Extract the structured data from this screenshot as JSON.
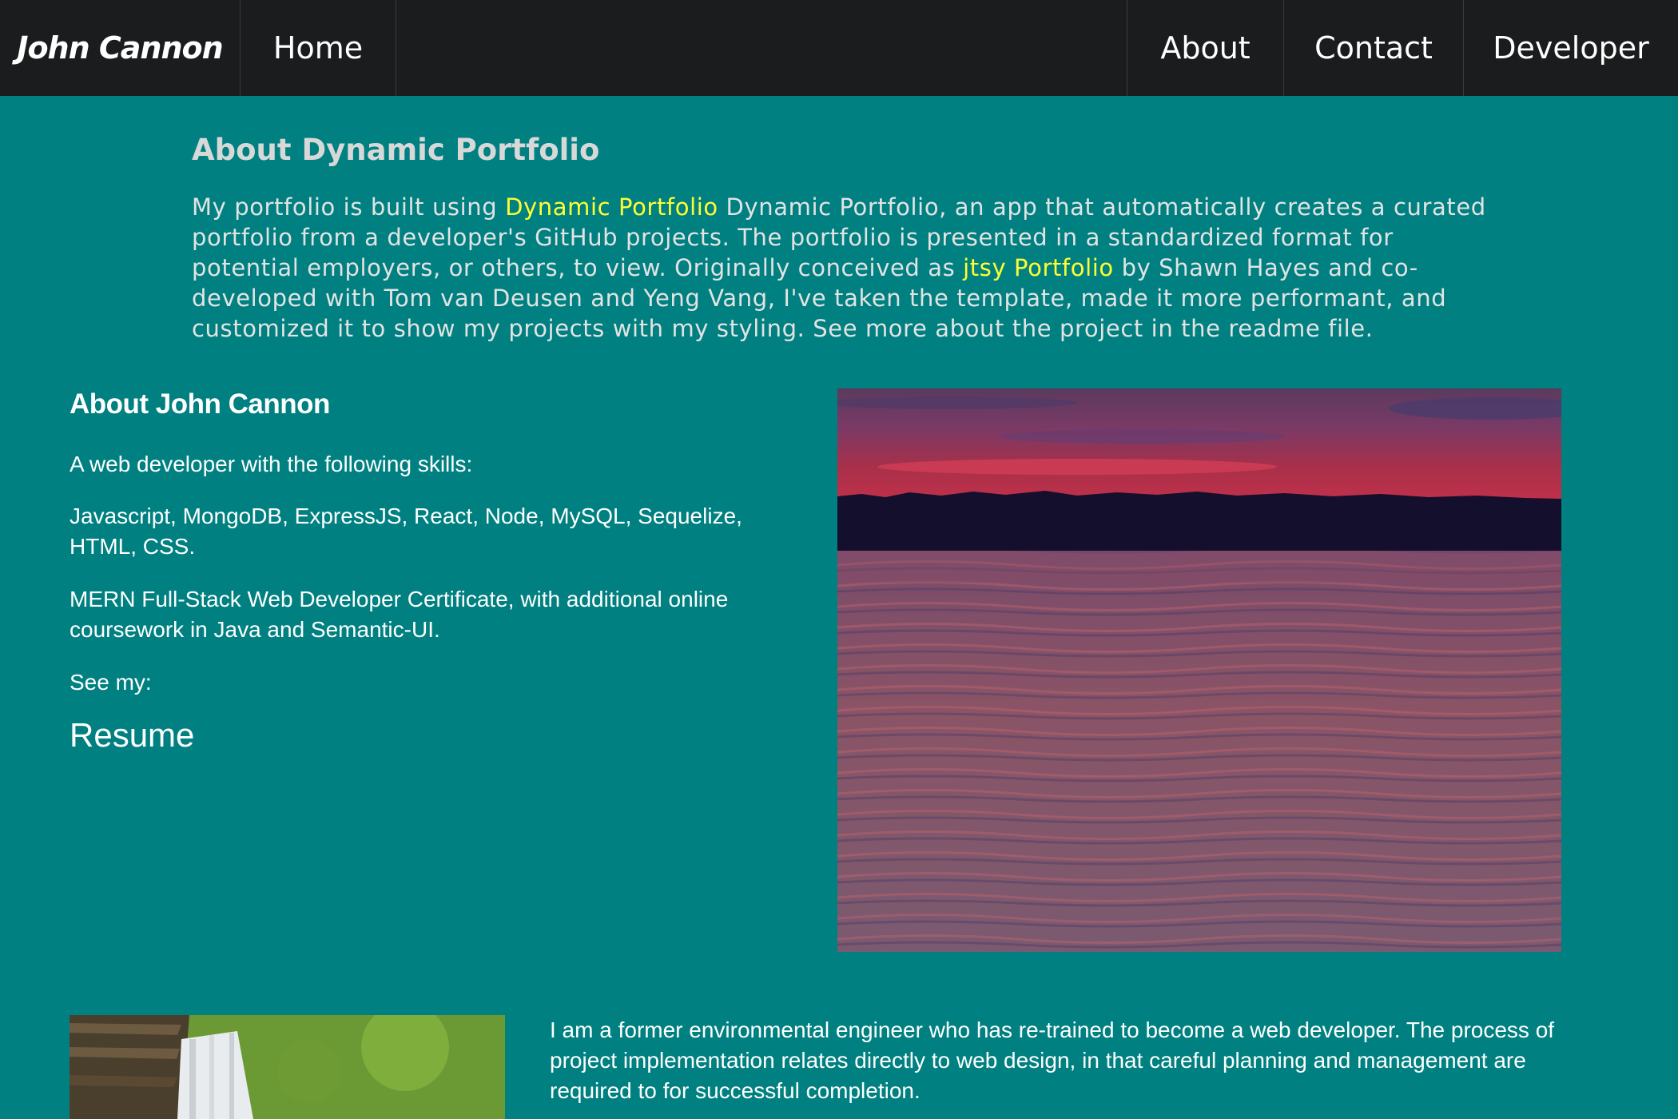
{
  "nav": {
    "brand": "John Cannon",
    "home": "Home",
    "about": "About",
    "contact": "Contact",
    "developer": "Developer"
  },
  "dynamic_portfolio": {
    "title": "About Dynamic Portfolio",
    "text_1": "My portfolio is built using ",
    "link_1": "Dynamic Portfolio",
    "text_2": " Dynamic Portfolio, an app that automatically creates a curated portfolio from a developer's GitHub projects. The portfolio is presented in a standardized format for potential employers, or others, to view. Originally conceived as ",
    "link_2": "jtsy Portfolio",
    "text_3": " by Shawn Hayes and co-developed with Tom van Deusen and Yeng Vang, I've taken the template, made it more performant, and customized it to show my projects with my styling. See more about the project in the readme file."
  },
  "about_john": {
    "title": "About John Cannon",
    "intro": "A web developer with the following skills:",
    "skills": "Javascript, MongoDB, ExpressJS, React, Node, MySQL, Sequelize, HTML, CSS.",
    "certificate": "MERN Full-Stack Web Developer Certificate, with additional online coursework in Java and Semantic-UI.",
    "see_my": "See my:",
    "resume_link": "Resume"
  },
  "bio": {
    "text": "I am a former environmental engineer who has re-trained to become a web developer. The process of project implementation relates directly to web design, in that careful planning and management are required to for successful completion."
  },
  "colors": {
    "page_background": "#008080",
    "nav_background": "#1b1c1d",
    "link_highlight": "#ffff33"
  }
}
